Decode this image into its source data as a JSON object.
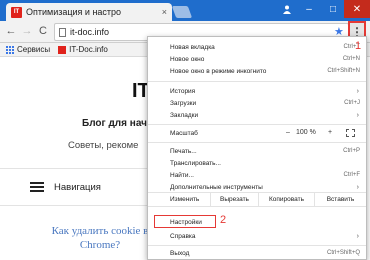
{
  "window": {
    "tab_title": "Оптимизация и настро",
    "tab_favicon_text": "IT",
    "close_tab_glyph": "×",
    "user_icon": "user-icon",
    "minimize_glyph": "–",
    "maximize_glyph": "□",
    "close_glyph": "✕"
  },
  "toolbar": {
    "back_glyph": "←",
    "forward_glyph": "→",
    "reload_glyph": "C",
    "url": "it-doc.info",
    "star_glyph": "★",
    "menu_glyph": "⋮"
  },
  "bookmarks": [
    {
      "label": "Сервисы",
      "icon": "apps-icon"
    },
    {
      "label": "IT-Doc.info",
      "icon": "site-favicon-icon"
    }
  ],
  "page": {
    "logo": "IT-",
    "tagline": "Блог для начи",
    "subtagline": "Советы, рекоме",
    "nav_label": "Навигация",
    "article_title": "Как удалить cookie в Chrome?"
  },
  "menu": {
    "new_tab": {
      "label": "Новая вкладка",
      "shortcut": "Ctrl+T"
    },
    "new_window": {
      "label": "Новое окно",
      "shortcut": "Ctrl+N"
    },
    "incognito": {
      "label": "Новое окно в режиме инкогнито",
      "shortcut": "Ctrl+Shift+N"
    },
    "history": {
      "label": "История"
    },
    "downloads": {
      "label": "Загрузки",
      "shortcut": "Ctrl+J"
    },
    "bookmarks": {
      "label": "Закладки"
    },
    "zoom": {
      "label": "Масштаб",
      "minus": "–",
      "value": "100 %",
      "plus": "+"
    },
    "print": {
      "label": "Печать...",
      "shortcut": "Ctrl+P"
    },
    "cast": {
      "label": "Транслировать..."
    },
    "find": {
      "label": "Найти...",
      "shortcut": "Ctrl+F"
    },
    "more_tools": {
      "label": "Дополнительные инструменты"
    },
    "edit": {
      "label": "Изменить",
      "cut": "Вырезать",
      "copy": "Копировать",
      "paste": "Вставить"
    },
    "settings": {
      "label": "Настройки"
    },
    "help": {
      "label": "Справка"
    },
    "exit": {
      "label": "Выход",
      "shortcut": "Ctrl+Shift+Q"
    },
    "submenu_arrow": "›"
  },
  "annotations": {
    "callout_1": "1",
    "callout_2": "2",
    "highlight_color": "#e53935"
  }
}
